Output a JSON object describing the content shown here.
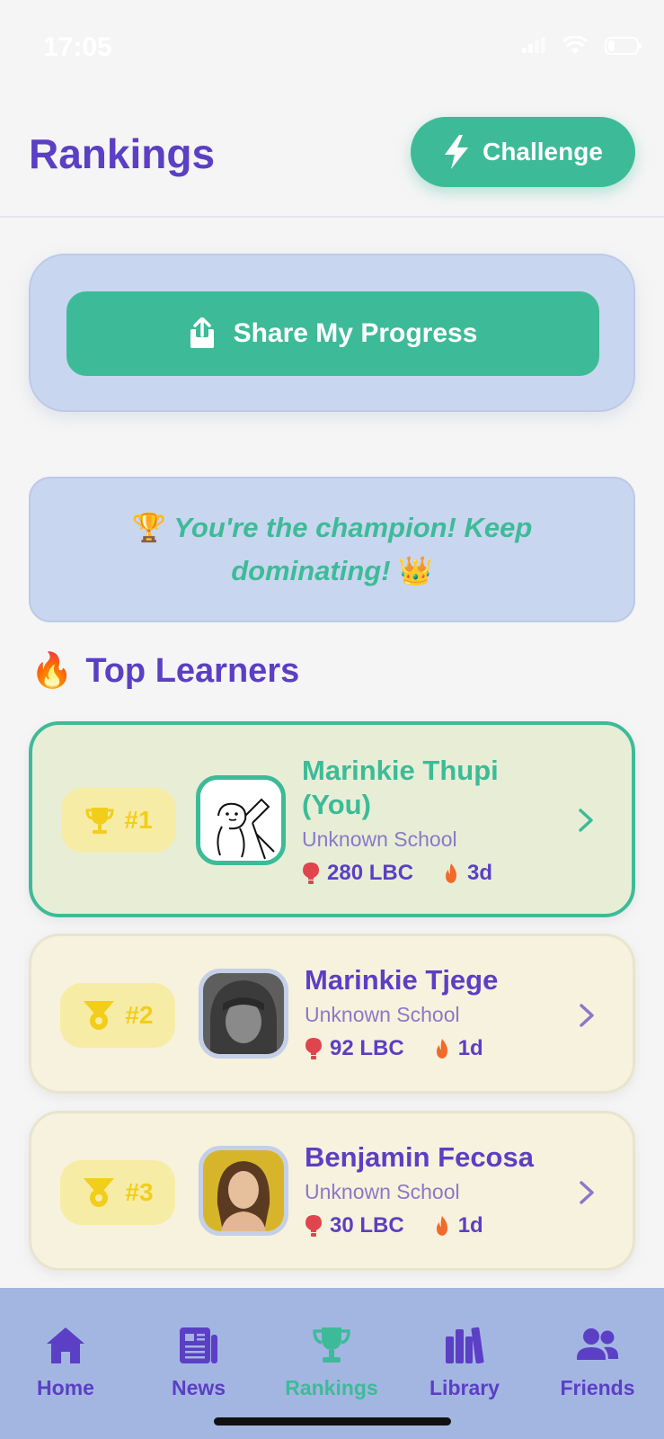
{
  "status_bar": {
    "time": "17:05"
  },
  "header": {
    "title": "Rankings",
    "challenge_label": "Challenge"
  },
  "share": {
    "label": "Share My Progress"
  },
  "banner": {
    "trophy": "🏆",
    "text": "You're the champion! Keep dominating!",
    "crown": "👑"
  },
  "section": {
    "emoji": "🔥",
    "title": "Top Learners"
  },
  "leaderboard": [
    {
      "rank": "#1",
      "name": "Marinkie Thupi (You)",
      "school": "Unknown School",
      "lbc": "280 LBC",
      "streak": "3d"
    },
    {
      "rank": "#2",
      "name": "Marinkie Tjege",
      "school": "Unknown School",
      "lbc": "92 LBC",
      "streak": "1d"
    },
    {
      "rank": "#3",
      "name": "Benjamin Fecosa",
      "school": "Unknown School",
      "lbc": "30 LBC",
      "streak": "1d"
    }
  ],
  "tabbar": {
    "items": [
      {
        "label": "Home",
        "icon": "home-icon"
      },
      {
        "label": "News",
        "icon": "news-icon"
      },
      {
        "label": "Rankings",
        "icon": "trophy-icon"
      },
      {
        "label": "Library",
        "icon": "library-icon"
      },
      {
        "label": "Friends",
        "icon": "friends-icon"
      }
    ],
    "active": "Rankings"
  },
  "colors": {
    "primary": "#5b3fc4",
    "accent": "#3dbb98",
    "gold": "#f2ce1a",
    "card_blue": "#c9d6ef",
    "tabbar": "#a3b6e2"
  }
}
